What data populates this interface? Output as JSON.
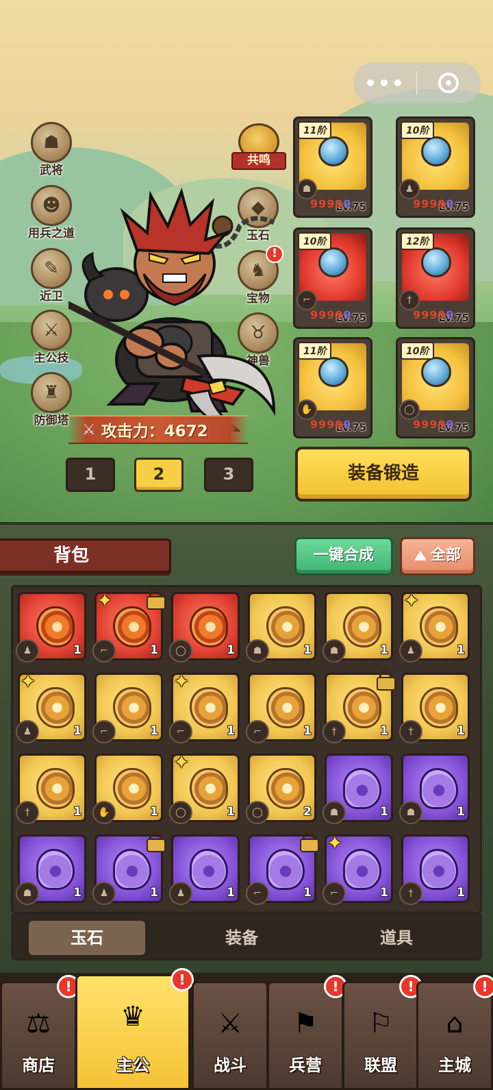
{
  "capsule": {
    "more": "•••",
    "close_icon": "target-icon"
  },
  "left_menu": [
    {
      "label": "武将",
      "icon": "general-icon"
    },
    {
      "label": "用兵之道",
      "icon": "tactics-icon"
    },
    {
      "label": "近卫",
      "icon": "guard-icon"
    },
    {
      "label": "主公技",
      "icon": "skill-icon"
    },
    {
      "label": "防御塔",
      "icon": "tower-icon"
    }
  ],
  "right_menu": {
    "resonance": "共鸣",
    "items": [
      {
        "label": "玉石",
        "icon": "jade-icon"
      },
      {
        "label": "宝物",
        "icon": "treasure-icon",
        "badge": "!"
      },
      {
        "label": "神兽",
        "icon": "beast-icon"
      }
    ]
  },
  "power": {
    "label": "攻击力：4672"
  },
  "loadouts": [
    "1",
    "2",
    "3"
  ],
  "loadout_active": "2",
  "equipment": [
    {
      "tier": "11阶",
      "level": "Lv.75",
      "value": "99999",
      "color": "gold",
      "slot": "helmet"
    },
    {
      "tier": "10阶",
      "level": "Lv.75",
      "value": "99999",
      "color": "gold",
      "slot": "armor"
    },
    {
      "tier": "10阶",
      "level": "Lv.75",
      "value": "99999",
      "color": "red",
      "slot": "boots"
    },
    {
      "tier": "12阶",
      "level": "Lv.75",
      "value": "99999",
      "color": "red",
      "slot": "weapon"
    },
    {
      "tier": "11阶",
      "level": "Lv.75",
      "value": "99999",
      "color": "gold",
      "slot": "gloves"
    },
    {
      "tier": "10阶",
      "level": "Lv.75",
      "value": "99999",
      "color": "gold",
      "slot": "ring"
    }
  ],
  "forge_label": "装备锻造",
  "bag": {
    "title": "背包",
    "merge_label": "一键合成",
    "filter_label": "全部",
    "items": [
      {
        "color": "red",
        "count": "1",
        "slot": "armor"
      },
      {
        "color": "red",
        "count": "1",
        "slot": "boots",
        "star": true,
        "lock": true
      },
      {
        "color": "red",
        "count": "1",
        "slot": "ring"
      },
      {
        "color": "gold",
        "count": "1",
        "slot": "helmet"
      },
      {
        "color": "gold",
        "count": "1",
        "slot": "helmet"
      },
      {
        "color": "gold",
        "count": "1",
        "slot": "armor",
        "star": true
      },
      {
        "color": "gold",
        "count": "1",
        "slot": "armor",
        "star": true
      },
      {
        "color": "gold",
        "count": "1",
        "slot": "boots"
      },
      {
        "color": "gold",
        "count": "1",
        "slot": "boots",
        "star": true
      },
      {
        "color": "gold",
        "count": "1",
        "slot": "boots"
      },
      {
        "color": "gold",
        "count": "1",
        "slot": "weapon",
        "lock": true
      },
      {
        "color": "gold",
        "count": "1",
        "slot": "weapon"
      },
      {
        "color": "gold",
        "count": "1",
        "slot": "weapon"
      },
      {
        "color": "gold",
        "count": "1",
        "slot": "gloves"
      },
      {
        "color": "gold",
        "count": "1",
        "slot": "ring",
        "star": true
      },
      {
        "color": "gold",
        "count": "2",
        "slot": "ring"
      },
      {
        "color": "purple",
        "count": "1",
        "slot": "helmet"
      },
      {
        "color": "purple",
        "count": "1",
        "slot": "helmet"
      },
      {
        "color": "purple",
        "count": "1",
        "slot": "helmet"
      },
      {
        "color": "purple",
        "count": "1",
        "slot": "armor",
        "lock": true
      },
      {
        "color": "purple",
        "count": "1",
        "slot": "armor"
      },
      {
        "color": "purple",
        "count": "1",
        "slot": "boots",
        "lock": true
      },
      {
        "color": "purple",
        "count": "1",
        "slot": "boots",
        "star": true
      },
      {
        "color": "purple",
        "count": "1",
        "slot": "weapon"
      }
    ],
    "tabs": [
      "玉石",
      "装备",
      "道具"
    ],
    "tab_active": "玉石"
  },
  "nav": [
    {
      "label": "商店",
      "icon": "shop-icon",
      "badge": "!"
    },
    {
      "label": "主公",
      "icon": "lord-icon",
      "badge": "!",
      "active": true
    },
    {
      "label": "战斗",
      "icon": "battle-icon"
    },
    {
      "label": "兵营",
      "icon": "barracks-icon",
      "badge": "!"
    },
    {
      "label": "联盟",
      "icon": "alliance-icon",
      "badge": "!"
    },
    {
      "label": "主城",
      "icon": "city-icon",
      "badge": "!"
    }
  ],
  "colors": {
    "gold": "#f2c752",
    "red": "#e24334",
    "purple": "#8553d8",
    "accent": "#f6cf45",
    "merge_green": "#3fb472"
  }
}
